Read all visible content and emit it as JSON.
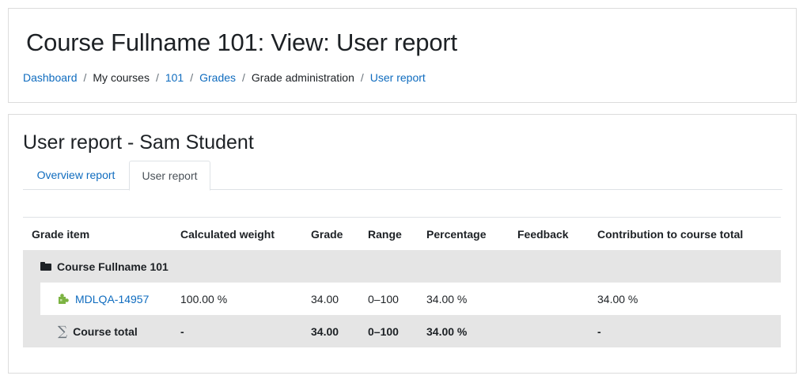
{
  "header": {
    "title": "Course Fullname 101: View: User report",
    "breadcrumb": [
      {
        "label": "Dashboard",
        "link": true
      },
      {
        "label": "My courses",
        "link": false
      },
      {
        "label": "101",
        "link": true
      },
      {
        "label": "Grades",
        "link": true
      },
      {
        "label": "Grade administration",
        "link": false
      },
      {
        "label": "User report",
        "link": true
      }
    ],
    "separator": "/"
  },
  "report": {
    "title": "User report - Sam Student",
    "tabs": [
      {
        "label": "Overview report",
        "active": false
      },
      {
        "label": "User report",
        "active": true
      }
    ],
    "columns": {
      "item": "Grade item",
      "weight": "Calculated weight",
      "grade": "Grade",
      "range": "Range",
      "percentage": "Percentage",
      "feedback": "Feedback",
      "contribution": "Contribution to course total"
    },
    "category": {
      "icon": "folder-icon",
      "name": "Course Fullname 101"
    },
    "item": {
      "icon": "puzzle-piece-icon",
      "name": "MDLQA-14957",
      "weight": "100.00 %",
      "grade": "34.00",
      "range": "0–100",
      "percentage": "34.00 %",
      "feedback": "",
      "contribution": "34.00 %"
    },
    "total": {
      "icon": "sigma-icon",
      "name": "Course total",
      "weight": "-",
      "grade": "34.00",
      "range": "0–100",
      "percentage": "34.00 %",
      "feedback": "",
      "contribution": "-"
    }
  },
  "colors": {
    "link": "#0f6cbf",
    "row_shade": "#e5e5e5",
    "border": "#dcdcdc"
  }
}
